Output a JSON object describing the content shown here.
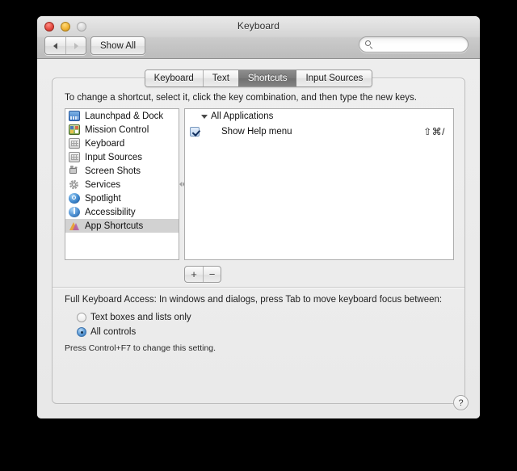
{
  "window": {
    "title": "Keyboard",
    "traffic_lights": [
      {
        "name": "close",
        "color": "#e4493f"
      },
      {
        "name": "minimize",
        "color": "#f0b233"
      },
      {
        "name": "zoom",
        "color": "#d8d8d8",
        "disabled": true
      }
    ]
  },
  "toolbar": {
    "back_label": "◀",
    "forward_label": "▶",
    "show_all_label": "Show All",
    "search": {
      "value": "",
      "placeholder": "",
      "icon": "search-icon"
    }
  },
  "tabs": [
    {
      "label": "Keyboard",
      "active": false
    },
    {
      "label": "Text",
      "active": false
    },
    {
      "label": "Shortcuts",
      "active": true
    },
    {
      "label": "Input Sources",
      "active": false
    }
  ],
  "main": {
    "hint": "To change a shortcut, select it, click the key combination, and then type the new keys.",
    "categories": [
      {
        "label": "Launchpad & Dock",
        "icon": "launchpad-dock-icon",
        "selected": false
      },
      {
        "label": "Mission Control",
        "icon": "mission-control-icon",
        "selected": false
      },
      {
        "label": "Keyboard",
        "icon": "keyboard-icon",
        "selected": false
      },
      {
        "label": "Input Sources",
        "icon": "input-sources-icon",
        "selected": false
      },
      {
        "label": "Screen Shots",
        "icon": "screen-shots-icon",
        "selected": false
      },
      {
        "label": "Services",
        "icon": "services-gear-icon",
        "selected": false
      },
      {
        "label": "Spotlight",
        "icon": "spotlight-icon",
        "selected": false
      },
      {
        "label": "Accessibility",
        "icon": "accessibility-icon",
        "selected": false
      },
      {
        "label": "App Shortcuts",
        "icon": "app-shortcuts-icon",
        "selected": true
      }
    ],
    "shortcut_groups": [
      {
        "label": "All Applications",
        "expanded": true,
        "shortcuts": [
          {
            "label": "Show Help menu",
            "combo": "⇧⌘/",
            "checked": true
          }
        ]
      }
    ],
    "add_button_label": "+",
    "remove_button_label": "−"
  },
  "full_keyboard_access": {
    "heading": "Full Keyboard Access: In windows and dialogs, press Tab to move keyboard focus between:",
    "options": [
      {
        "label": "Text boxes and lists only",
        "selected": false
      },
      {
        "label": "All controls",
        "selected": true
      }
    ],
    "note": "Press Control+F7 to change this setting."
  },
  "help_button_label": "?"
}
